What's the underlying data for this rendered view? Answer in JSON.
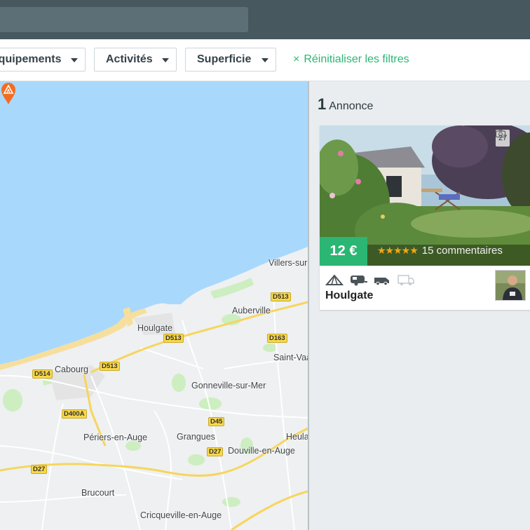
{
  "filters": [
    {
      "label": "Équipements"
    },
    {
      "label": "Activités"
    },
    {
      "label": "Superficie"
    }
  ],
  "reset": {
    "icon": "close-icon",
    "label": "Réinitialiser les filtres"
  },
  "map": {
    "places": [
      "Villers-sur-Mer",
      "Auberville",
      "Houlgate",
      "Cabourg",
      "Saint-Vaast-en-Auge",
      "Gonneville-sur-Mer",
      "Périers-en-Auge",
      "Grangues",
      "Douville-en-Auge",
      "Heuland",
      "Brucourt",
      "Cricqueville-en-Auge"
    ],
    "roads": [
      "D513",
      "D513",
      "D513",
      "D514",
      "D163",
      "D400A",
      "D45",
      "D27",
      "D27"
    ],
    "marker_icon": "tent-pin-icon"
  },
  "results": {
    "count": "1",
    "label": "Annonce"
  },
  "listing": {
    "price": "12 €",
    "rating": 4.5,
    "stars": "★★★★★",
    "reviews": "15 commentaires",
    "photo_count": "27",
    "title": "Houlgate",
    "vehicle_icons": [
      "tent-icon",
      "caravan-icon",
      "van-icon",
      "camper-icon"
    ]
  },
  "colors": {
    "accent": "#2bb673",
    "header": "#47585f",
    "water": "#a9d8fd",
    "stars": "#f3a712"
  }
}
